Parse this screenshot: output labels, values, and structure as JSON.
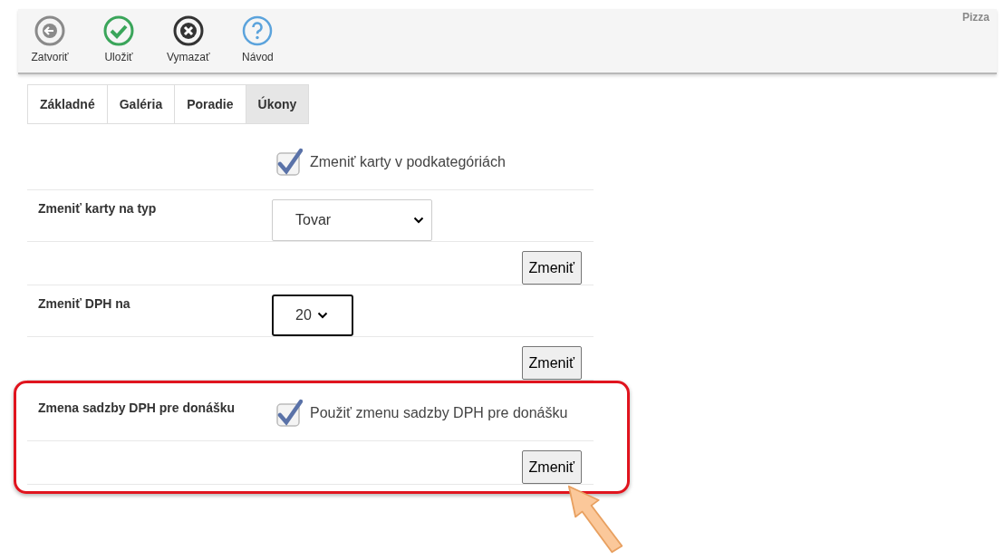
{
  "toolbar": {
    "buttons": [
      {
        "kind": "back",
        "label": "Zatvoriť"
      },
      {
        "kind": "check",
        "label": "Uložiť"
      },
      {
        "kind": "delete",
        "label": "Vymazať"
      },
      {
        "kind": "help",
        "label": "Návod"
      }
    ],
    "title": "Pizza"
  },
  "tabs": [
    {
      "label": "Základné",
      "selected": false
    },
    {
      "label": "Galéria",
      "selected": false
    },
    {
      "label": "Poradie",
      "selected": false
    },
    {
      "label": "Úkony",
      "selected": true
    }
  ],
  "sections": [
    {
      "highlighted": false,
      "rows": [
        {
          "kind": "checkbox",
          "text": "Zmeniť karty v podkategóriách",
          "checked": true
        }
      ]
    },
    {
      "highlighted": false,
      "rows": [
        {
          "kind": "select",
          "label": "Zmeniť karty na typ",
          "value": "Tovar",
          "focused": false
        },
        {
          "kind": "button",
          "button": "Zmeniť"
        }
      ]
    },
    {
      "highlighted": false,
      "rows": [
        {
          "kind": "select",
          "label": "Zmeniť DPH na",
          "value": "20",
          "focused": true
        },
        {
          "kind": "button",
          "button": "Zmeniť"
        }
      ]
    },
    {
      "highlighted": true,
      "rows": [
        {
          "kind": "checkbox",
          "label": "Zmena sadzby DPH pre donášku",
          "text": "Použiť zmenu sadzby DPH pre donášku",
          "checked": true
        },
        {
          "kind": "button",
          "button": "Zmeniť"
        }
      ]
    }
  ]
}
